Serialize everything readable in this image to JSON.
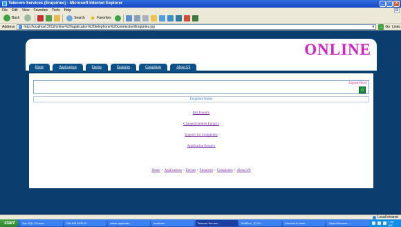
{
  "window": {
    "title": "Telecom Services (Enquiries) - Microsoft Internet Explorer",
    "controls": [
      "_",
      "□",
      "X"
    ]
  },
  "menu": [
    "File",
    "Edit",
    "View",
    "Favorites",
    "Tools",
    "Help"
  ],
  "toolbar": {
    "back_label": "Back",
    "search_label": "Search",
    "favorites_label": "Favorites"
  },
  "address": {
    "label": "Address",
    "url": "http://localhost:2012/online%20application%20telephone%20connection/Enquiries.jsp",
    "go_label": "Go",
    "links_label": "Links"
  },
  "site": {
    "title": "ONLINE",
    "nav": [
      "Home",
      "Applications",
      "Entries",
      "Enquiries",
      "Complaints",
      "About US"
    ],
    "logout": "Logout Here!",
    "heading": "Enquiries Home",
    "links": [
      "Bill Enquiry",
      "Changed number Enquiry",
      "Enquiry for Complaints",
      "Application Enquiry"
    ],
    "footer": [
      "Home",
      "Applications",
      "Entries",
      "Enquiries",
      "Complaints",
      "About US"
    ]
  },
  "status": {
    "text": "",
    "zone": "Local intranet"
  },
  "taskbar": {
    "start": "start",
    "tasks": [
      "Sun SQL Comma...",
      "ONLINE APPLIC...",
      "online applicatio...",
      "localhost",
      "Telecom Service...",
      "EditPlus - [C:\\Pr...",
      "Shortcut to tomc...",
      "Object Browser -..."
    ],
    "active_index": 4,
    "clock": "1:06 AM"
  },
  "colors": {
    "page_background": "#0b3d6e",
    "nav_tab": "#0b5088",
    "site_title": "#d61fc6",
    "link": "#7a2da8",
    "logout": "#e0208c"
  }
}
